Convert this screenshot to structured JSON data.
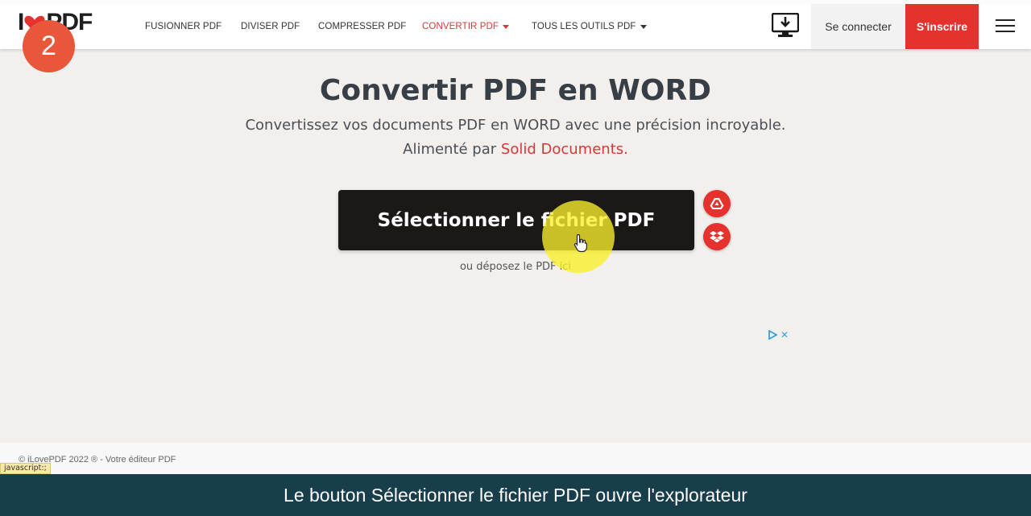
{
  "header": {
    "logo_prefix": "I",
    "logo_suffix": "PDF",
    "nav": [
      {
        "label": "FUSIONNER PDF",
        "dropdown": false
      },
      {
        "label": "DIVISER PDF",
        "dropdown": false
      },
      {
        "label": "COMPRESSER PDF",
        "dropdown": false
      },
      {
        "label": "CONVERTIR PDF",
        "dropdown": true,
        "active": true
      },
      {
        "label": "TOUS LES OUTILS PDF",
        "dropdown": true
      }
    ],
    "desktop_icon": "desktop-download-icon",
    "login_label": "Se connecter",
    "signup_label": "S'inscrire",
    "menu_icon": "hamburger-menu-icon"
  },
  "step_badge": "2",
  "main": {
    "title": "Convertir PDF en WORD",
    "subtitle": "Convertissez vos documents PDF en WORD avec une précision incroyable.",
    "powered_prefix": "Alimenté par",
    "powered_brand": "Solid Documents.",
    "select_button": "Sélectionner le fichier PDF",
    "drop_hint": "ou déposez le PDF ici",
    "cloud_buttons": [
      "google-drive-icon",
      "dropbox-icon"
    ]
  },
  "ad": {
    "close_glyph": "✕"
  },
  "footer": {
    "copyright": "© iLovePDF 2022 ® - Votre éditeur PDF",
    "status_tooltip": "javascript:;"
  },
  "caption": "Le bouton Sélectionner le fichier PDF ouvre l'explorateur",
  "colors": {
    "brand_red": "#e5322d",
    "active_nav": "#d23a37",
    "step_badge": "#e8573a",
    "caption_bg": "#173e4a",
    "button_dark": "#1b1817",
    "highlight": "#f8f028"
  }
}
